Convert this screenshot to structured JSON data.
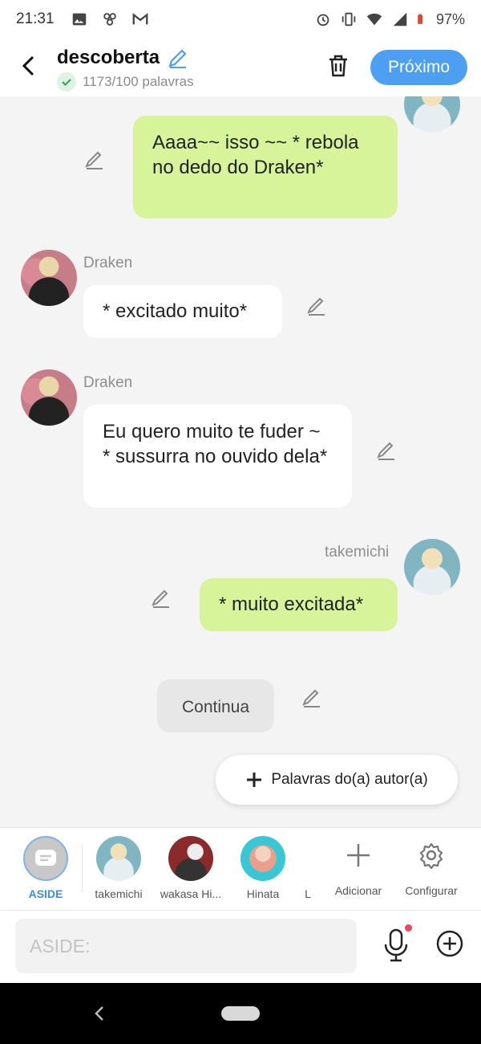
{
  "status_bar": {
    "time": "21:31",
    "battery": "97%"
  },
  "header": {
    "title": "descoberta",
    "word_count": "1173/100 palavras",
    "next_label": "Próximo"
  },
  "messages": [
    {
      "speaker": "",
      "side": "right",
      "text": "Aaaa~~ isso ~~ * rebola no dedo do Draken*"
    },
    {
      "speaker": "Draken",
      "side": "left",
      "text": "* excitado muito*"
    },
    {
      "speaker": "Draken",
      "side": "left",
      "text": "Eu quero muito te fuder ~ * sussurra no ouvido dela*"
    },
    {
      "speaker": "takemichi",
      "side": "right",
      "text": "* muito excitada*"
    }
  ],
  "continue_label": "Continua",
  "author_words_label": "Palavras do(a) autor(a)",
  "characters": [
    {
      "name": "ASIDE",
      "active": true
    },
    {
      "name": "takemichi"
    },
    {
      "name": "wakasa Hi..."
    },
    {
      "name": "Hinata"
    },
    {
      "name": "L"
    }
  ],
  "tools": {
    "add_label": "Adicionar",
    "settings_label": "Configurar"
  },
  "input": {
    "placeholder": "ASIDE:"
  },
  "colors": {
    "accent": "#4da0f1",
    "my_bubble": "#d8f49a",
    "other_bubble": "#ffffff",
    "active_tab": "#3d8ee0"
  },
  "icons": [
    "back-arrow-icon",
    "edit-pencil-icon",
    "check-icon",
    "trash-icon",
    "plus-icon",
    "gear-icon",
    "microphone-icon",
    "add-circle-icon"
  ]
}
